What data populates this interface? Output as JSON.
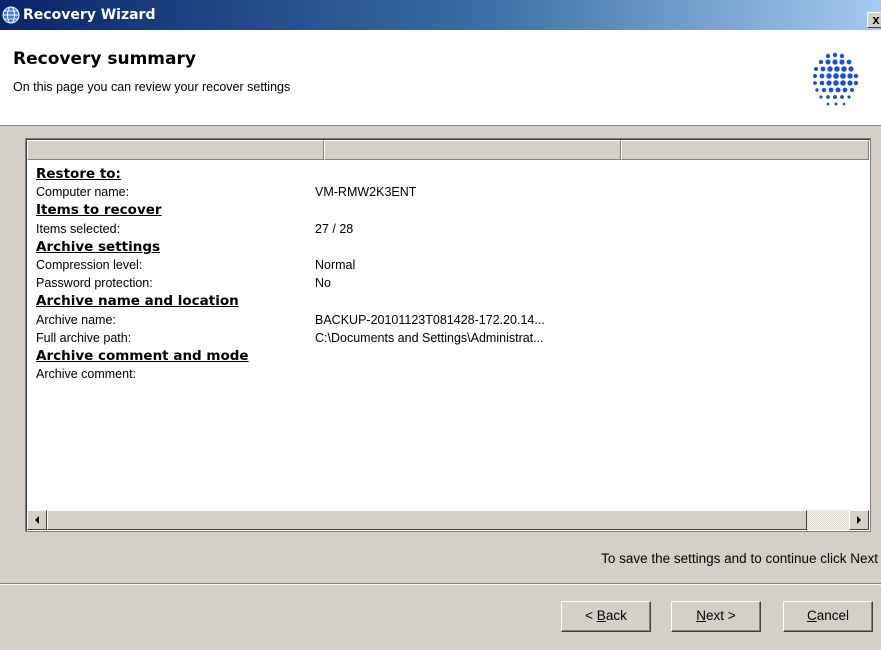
{
  "window": {
    "title": "Recovery Wizard",
    "close_label": "x"
  },
  "header": {
    "title": "Recovery summary",
    "subtitle": "On this page you can review your recover settings"
  },
  "summary": {
    "rows": [
      {
        "type": "section",
        "label": "Restore to:",
        "value": ""
      },
      {
        "type": "item",
        "label": "Computer name:",
        "value": "VM-RMW2K3ENT"
      },
      {
        "type": "section",
        "label": "Items to recover",
        "value": ""
      },
      {
        "type": "item",
        "label": "Items selected:",
        "value": "27 / 28"
      },
      {
        "type": "section",
        "label": "Archive settings",
        "value": ""
      },
      {
        "type": "item",
        "label": "Compression level:",
        "value": "Normal"
      },
      {
        "type": "item",
        "label": "Password protection:",
        "value": "No"
      },
      {
        "type": "section",
        "label": "Archive name and location",
        "value": ""
      },
      {
        "type": "item",
        "label": "Archive name:",
        "value": "BACKUP-20101123T081428-172.20.14..."
      },
      {
        "type": "item",
        "label": "Full archive path:",
        "value": "C:\\Documents and Settings\\Administrat..."
      },
      {
        "type": "section",
        "label": "Archive comment and mode",
        "value": ""
      },
      {
        "type": "item",
        "label": "Archive comment:",
        "value": ""
      }
    ]
  },
  "hint": "To save the settings and to continue click Next",
  "buttons": {
    "back": {
      "prefix": "< ",
      "accel": "B",
      "rest": "ack"
    },
    "next": {
      "prefix": "",
      "accel": "N",
      "rest": "ext >"
    },
    "cancel": {
      "prefix": "",
      "accel": "C",
      "rest": "ancel"
    }
  },
  "colors": {
    "face": "#d4d0c8",
    "titlebar_start": "#0a246a",
    "titlebar_end": "#a6caf0",
    "logo_blue": "#1a4fd6"
  },
  "icons": {
    "app": "globe-icon",
    "logo": "dot-sphere-logo",
    "scroll_left": "arrow-left-icon",
    "scroll_right": "arrow-right-icon"
  }
}
